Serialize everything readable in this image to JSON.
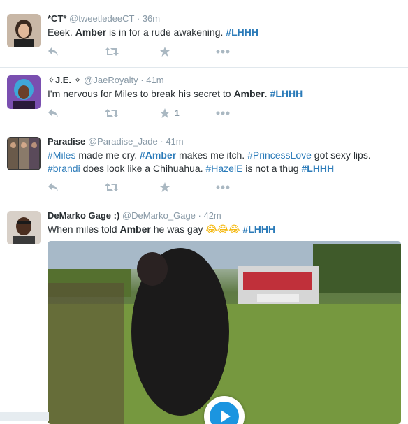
{
  "colors": {
    "link": "#2b7bb9",
    "action_icon": "#aab8c2",
    "meta": "#8899a6"
  },
  "tweets": [
    {
      "fullname": "*CT*",
      "username": "@tweetledeeCT",
      "time": "· 36m",
      "text": {
        "t1": "Eeek. ",
        "b1": "Amber",
        "t2": " is in for a rude awakening. ",
        "h1": "#LHHH"
      },
      "like_count": ""
    },
    {
      "fullname": "✧J.E. ✧",
      "username": "@JaeRoyalty",
      "time": "· 41m",
      "text": {
        "t1": "I'm nervous for Miles to break his secret to ",
        "b1": "Amber",
        "t2": ". ",
        "h1": "#LHHH"
      },
      "like_count": "1"
    },
    {
      "fullname": "Paradise",
      "username": "@Paradise_Jade",
      "time": "· 41m",
      "text": {
        "h1": "#Miles",
        "t1": " made me cry. ",
        "h2": "#Amber",
        "t2": " makes me itch. ",
        "h3": "#PrincessLove",
        "t3": " got sexy lips.",
        "h4": "#brandi",
        "t4": " does look like a Chihuahua. ",
        "h5": "#HazelE",
        "t5": " is not a thug ",
        "h6": "#LHHH"
      },
      "like_count": ""
    },
    {
      "fullname": "DeMarko Gage :)",
      "username": "@DeMarko_Gage",
      "time": "· 42m",
      "text": {
        "t1": "When miles told ",
        "b1": "Amber",
        "t2": " he was gay ",
        "emoji": "😂😂😂",
        "h1": "#LHHH"
      }
    }
  ]
}
